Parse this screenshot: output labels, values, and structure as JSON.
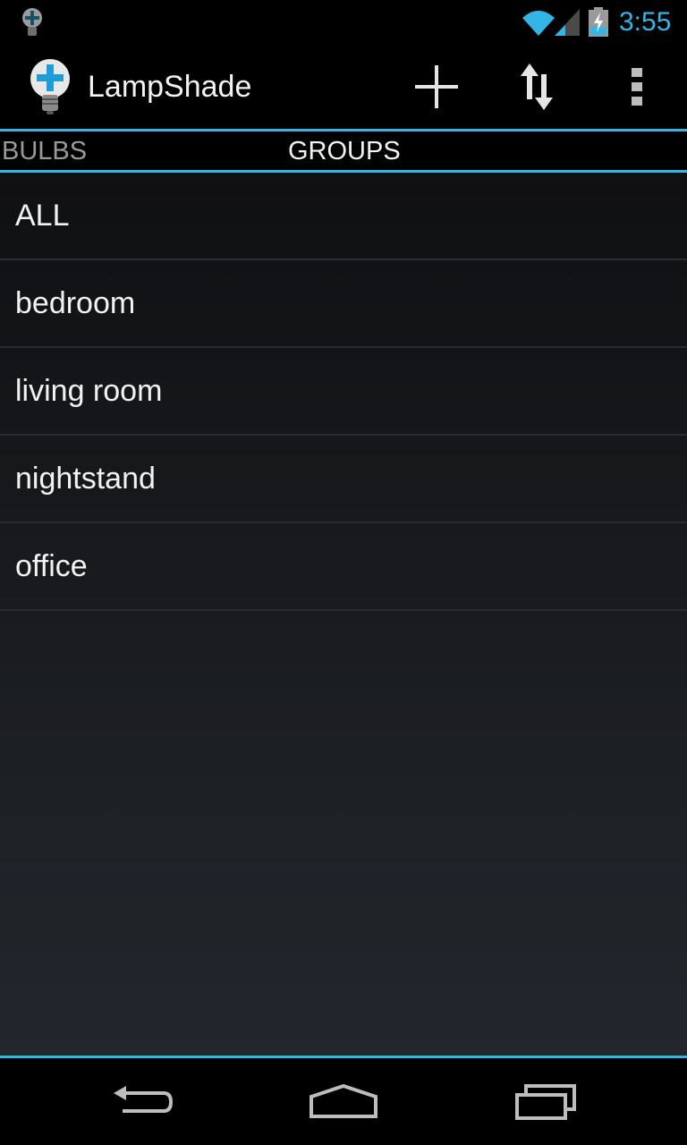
{
  "status_bar": {
    "time": "3:55",
    "icons": [
      "lightbulb-notification-icon",
      "wifi-icon",
      "signal-icon",
      "battery-charging-icon"
    ]
  },
  "action_bar": {
    "title": "LampShade",
    "icons": [
      "app-lightbulb-icon",
      "add-icon",
      "sort-icon",
      "overflow-menu-icon"
    ]
  },
  "tabs": [
    {
      "label": "BULBS",
      "selected": false
    },
    {
      "label": "GROUPS",
      "selected": true
    }
  ],
  "groups": [
    {
      "name": "ALL"
    },
    {
      "name": "bedroom"
    },
    {
      "name": "living room"
    },
    {
      "name": "nightstand"
    },
    {
      "name": "office"
    }
  ],
  "nav_bar": {
    "icons": [
      "back-icon",
      "home-icon",
      "recents-icon"
    ]
  },
  "colors": {
    "accent": "#33b5e5",
    "background": "#000000",
    "text": "#f2f2f2",
    "inactive_tab": "#9a9a9a"
  }
}
